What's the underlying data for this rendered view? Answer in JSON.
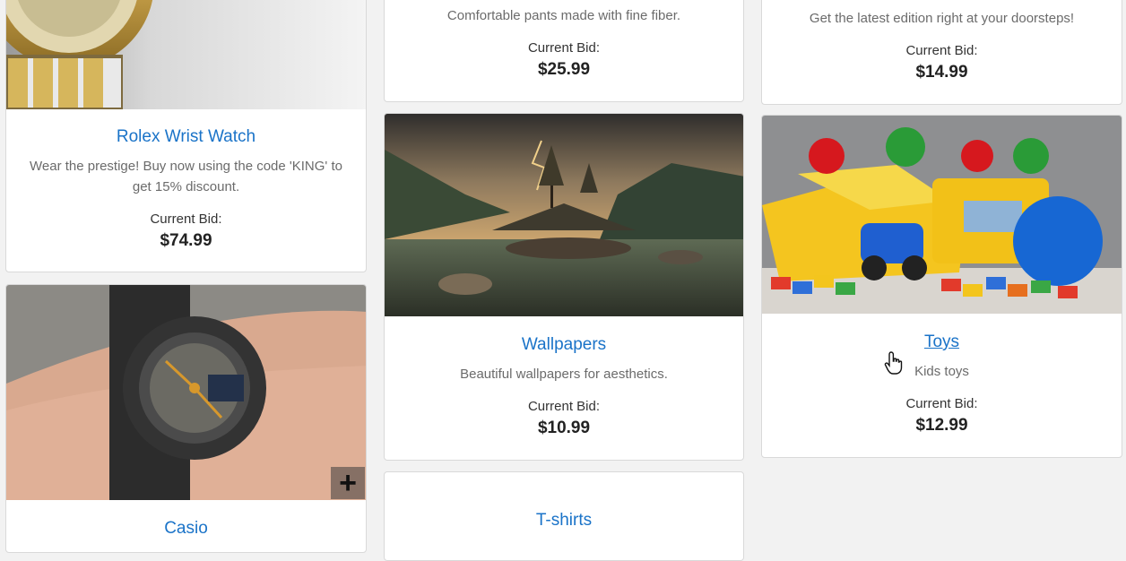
{
  "products": {
    "rolex": {
      "title": "Rolex Wrist Watch",
      "description": "Wear the prestige! Buy now using the code 'KING' to get 15% discount.",
      "bid_label": "Current Bid:",
      "bid": "$74.99",
      "image": "gold-watch-image"
    },
    "casio": {
      "title": "Casio",
      "image": "casio-watch-image",
      "action_icon": "plus-icon"
    },
    "pants": {
      "description": "Comfortable pants made with fine fiber.",
      "bid_label": "Current Bid:",
      "bid": "$25.99"
    },
    "wallpapers": {
      "title": "Wallpapers",
      "description": "Beautiful wallpapers for aesthetics.",
      "bid_label": "Current Bid:",
      "bid": "$10.99",
      "image": "landscape-image"
    },
    "tshirts": {
      "title": "T-shirts"
    },
    "newspaper": {
      "description": "Get the latest edition right at your doorsteps!",
      "bid_label": "Current Bid:",
      "bid": "$14.99"
    },
    "toys": {
      "title": "Toys",
      "description": "Kids toys",
      "bid_label": "Current Bid:",
      "bid": "$12.99",
      "image": "toys-image"
    }
  },
  "colors": {
    "title": "#1a73c8",
    "background": "#f2f2f2"
  },
  "cursor_icon": "hand-pointer-icon"
}
